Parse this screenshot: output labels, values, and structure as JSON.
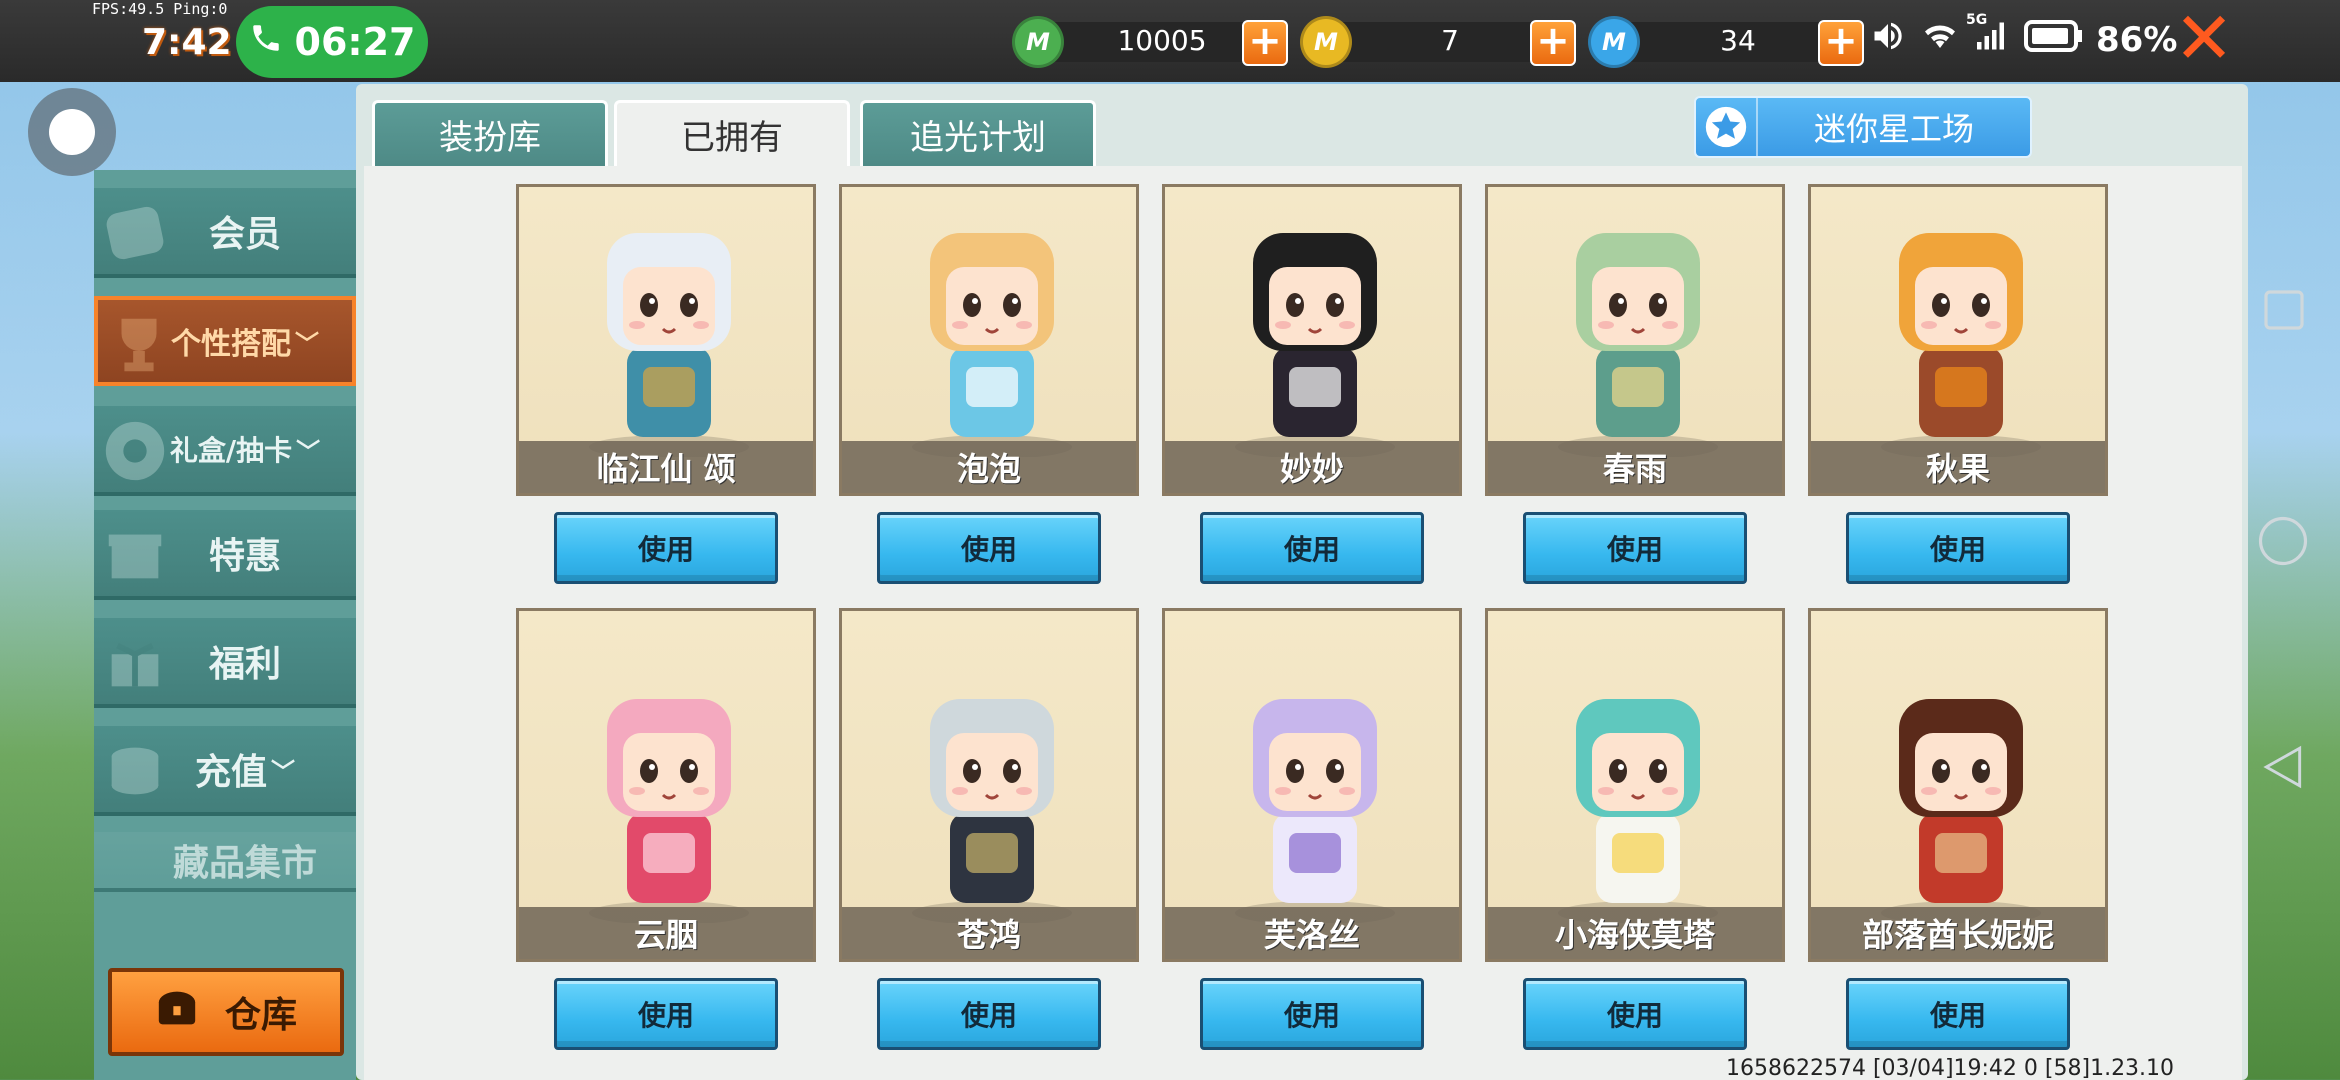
{
  "status_bar": {
    "fps_text": "FPS:49.5  Ping:0",
    "overlay_time": "7:42",
    "call_time": "06:27",
    "battery": "86%",
    "network": "5G"
  },
  "currencies": [
    {
      "name": "mini-bean-icon",
      "icon_letter": "M",
      "value": "10005",
      "color": "#4caf50"
    },
    {
      "name": "mini-coin-icon",
      "icon_letter": "M",
      "value": "7",
      "color": "#e8b923"
    },
    {
      "name": "mini-point-icon",
      "icon_letter": "M",
      "value": "34",
      "color": "#3aa6e8"
    }
  ],
  "tabs": [
    {
      "label": "装扮库",
      "active": false
    },
    {
      "label": "已拥有",
      "active": true
    },
    {
      "label": "追光计划",
      "active": false
    }
  ],
  "star_workshop_label": "迷你星工场",
  "sidebar": [
    {
      "label": "会员"
    },
    {
      "label": "个性搭配",
      "active": true
    },
    {
      "label": "礼盒/抽卡"
    },
    {
      "label": "特惠"
    },
    {
      "label": "福利"
    },
    {
      "label": "充值"
    },
    {
      "label": "藏品集市"
    }
  ],
  "warehouse_label": "仓库",
  "use_label": "使用",
  "skins_row1": [
    {
      "name": "临江仙 颂",
      "hair": "#e8eef5",
      "outfit": "#3f8fa8",
      "accent": "#d9a441"
    },
    {
      "name": "泡泡",
      "hair": "#f3c47a",
      "outfit": "#6cc7e6",
      "accent": "#ffffff"
    },
    {
      "name": "妙妙",
      "hair": "#1f1f1f",
      "outfit": "#2a2530",
      "accent": "#ffffff"
    },
    {
      "name": "春雨",
      "hair": "#a9cfa0",
      "outfit": "#5d9e8c",
      "accent": "#f2d98a"
    },
    {
      "name": "秋果",
      "hair": "#f0a43a",
      "outfit": "#9b4a2a",
      "accent": "#f08a1a"
    }
  ],
  "skins_row2": [
    {
      "name": "云胭",
      "hair": "#f4a9bf",
      "outfit": "#e24a6a",
      "accent": "#ffd7e3"
    },
    {
      "name": "苍鸿",
      "hair": "#cfd8dc",
      "outfit": "#2e3440",
      "accent": "#c9b46a"
    },
    {
      "name": "芙洛丝",
      "hair": "#c7b6ec",
      "outfit": "#ece8fb",
      "accent": "#8a6ccf"
    },
    {
      "name": "小海侠莫塔",
      "hair": "#5fc8be",
      "outfit": "#f6f6f0",
      "accent": "#f6d24a"
    },
    {
      "name": "部落酋长妮妮",
      "hair": "#5b2a1a",
      "outfit": "#c23a2a",
      "accent": "#e8c28a"
    }
  ],
  "footer_info": "1658622574  [03/04]19:42 0  [58]1.23.10"
}
